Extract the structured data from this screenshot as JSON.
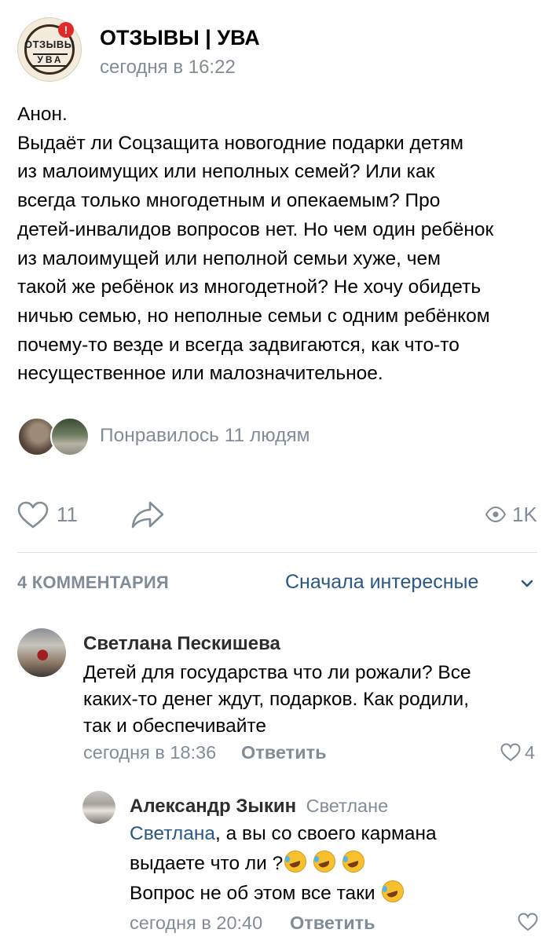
{
  "post": {
    "group_name": "ОТЗЫВЫ | УВА",
    "avatar_logo_top": "ОТЗЫВЫ",
    "avatar_logo_bottom": "УВА",
    "badge": "!",
    "time": "сегодня в 16:22",
    "text": "Анон.\nВыдаёт ли Соцзащита новогодние подарки детям\nиз малоимущих или неполных семей? Или как\nвсегда только многодетным и опекаемым? Про\nдетей-инвалидов вопросов нет. Но чем один ребёнок\nиз малоимущей или неполной семьи хуже, чем\nтакой же ребёнок из многодетной? Не хочу обидеть\nничью семью, но неполные семьи с одним ребёнком\nпочему-то везде и всегда задвигаются, как что-то\nнесущественное или малозначительное.",
    "liked_by": "Понравилось 11 людям",
    "like_count": "11",
    "views": "1K"
  },
  "comments_header": {
    "count_label": "4 КОММЕНТАРИЯ",
    "sort_label": "Сначала интересные"
  },
  "comments": [
    {
      "author": "Светлана Пескишева",
      "text": "Детей для государства что ли рожали? Все\nкаких-то денег ждут, подарков. Как родили,\nтак и обеспечивайте",
      "time": "сегодня в 18:36",
      "reply_label": "Ответить",
      "likes": "4"
    },
    {
      "author": "Александр Зыкин",
      "reply_to": "Светлане",
      "mention": "Светлана",
      "line1_rest": ", а вы со своего кармана",
      "line2": "выдаете что ли ?",
      "line3": "Вопрос не об этом все таки ",
      "time": "сегодня в 20:40",
      "reply_label": "Ответить"
    }
  ],
  "colors": {
    "secondary_text": "#818c99",
    "link": "#2a5885",
    "divider": "#dce1e6"
  },
  "icons": [
    "heart-icon",
    "share-icon",
    "eye-icon",
    "chevron-down-icon",
    "rofl-emoji"
  ]
}
